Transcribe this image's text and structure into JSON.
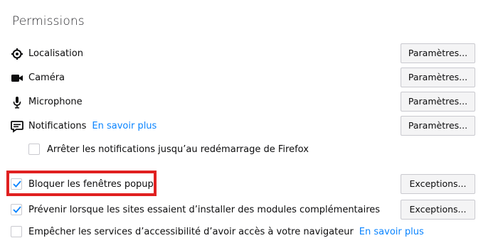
{
  "section": {
    "title": "Permissions"
  },
  "permissions": [
    {
      "label": "Localisation",
      "button": "Paramètres...",
      "icon": "location-icon"
    },
    {
      "label": "Caméra",
      "button": "Paramètres...",
      "icon": "camera-icon"
    },
    {
      "label": "Microphone",
      "button": "Paramètres...",
      "icon": "microphone-icon"
    },
    {
      "label": "Notifications",
      "link": "En savoir plus",
      "button": "Paramètres...",
      "icon": "notification-icon"
    }
  ],
  "pause_notifications": {
    "label": "Arrêter les notifications jusqu’au redémarrage de Firefox",
    "checked": false
  },
  "block_popups": {
    "label": "Bloquer les fenêtres popup",
    "checked": true,
    "button": "Exceptions..."
  },
  "warn_addons": {
    "label": "Prévenir lorsque les sites essaient d’installer des modules complémentaires",
    "checked": true,
    "button": "Exceptions..."
  },
  "block_accessibility": {
    "label": "Empêcher les services d’accessibilité d’avoir accès à votre navigateur",
    "link": "En savoir plus",
    "checked": false
  },
  "colors": {
    "link": "#0a84ff",
    "checkmark": "#0a84ff",
    "highlight": "#e02020"
  }
}
